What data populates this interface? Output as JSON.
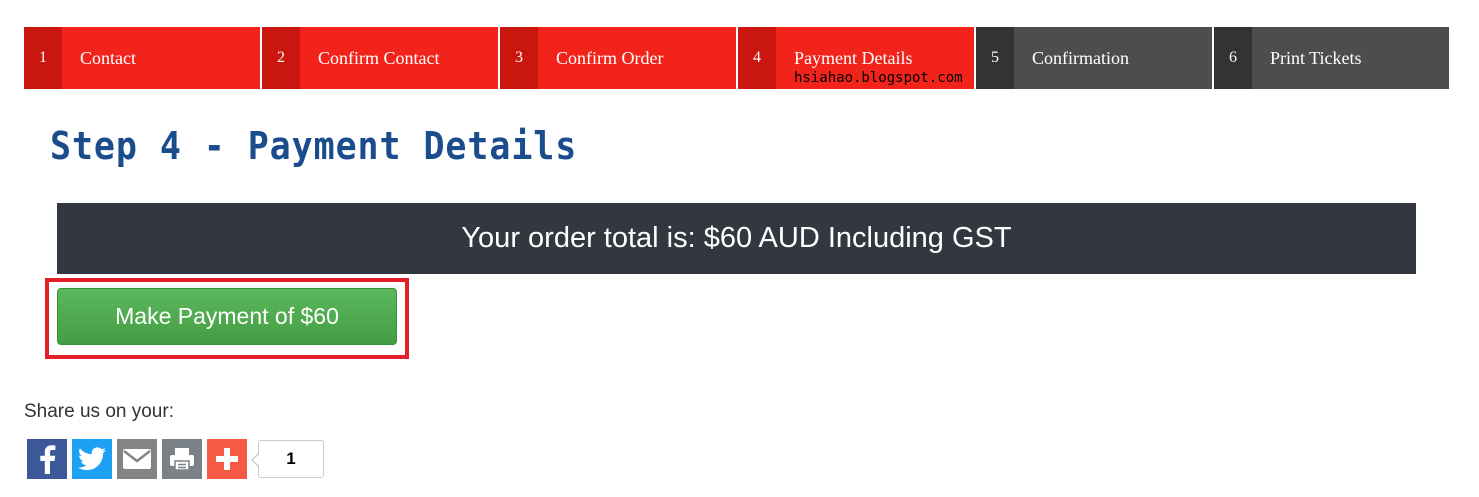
{
  "steps": [
    {
      "number": "1",
      "label": "Contact",
      "state": "done"
    },
    {
      "number": "2",
      "label": "Confirm Contact",
      "state": "done"
    },
    {
      "number": "3",
      "label": "Confirm Order",
      "state": "done"
    },
    {
      "number": "4",
      "label": "Payment Details",
      "state": "current"
    },
    {
      "number": "5",
      "label": "Confirmation",
      "state": "todo"
    },
    {
      "number": "6",
      "label": "Print Tickets",
      "state": "todo"
    }
  ],
  "watermark": "hsiahao.blogspot.com",
  "page": {
    "title": "Step 4 - Payment Details",
    "order_total": "Your order total is: $60 AUD Including GST",
    "pay_button": "Make Payment of $60"
  },
  "share": {
    "label": "Share us on your:",
    "buttons": [
      "facebook-icon",
      "twitter-icon",
      "email-icon",
      "print-icon",
      "plus-icon"
    ],
    "count": "1"
  },
  "colors": {
    "step_active": "#f2231a",
    "step_inactive": "#4d4d4d",
    "title": "#1b4d8c",
    "total_bar": "#333840",
    "pay_button": "#5cb85c",
    "highlight": "#e3202a"
  }
}
